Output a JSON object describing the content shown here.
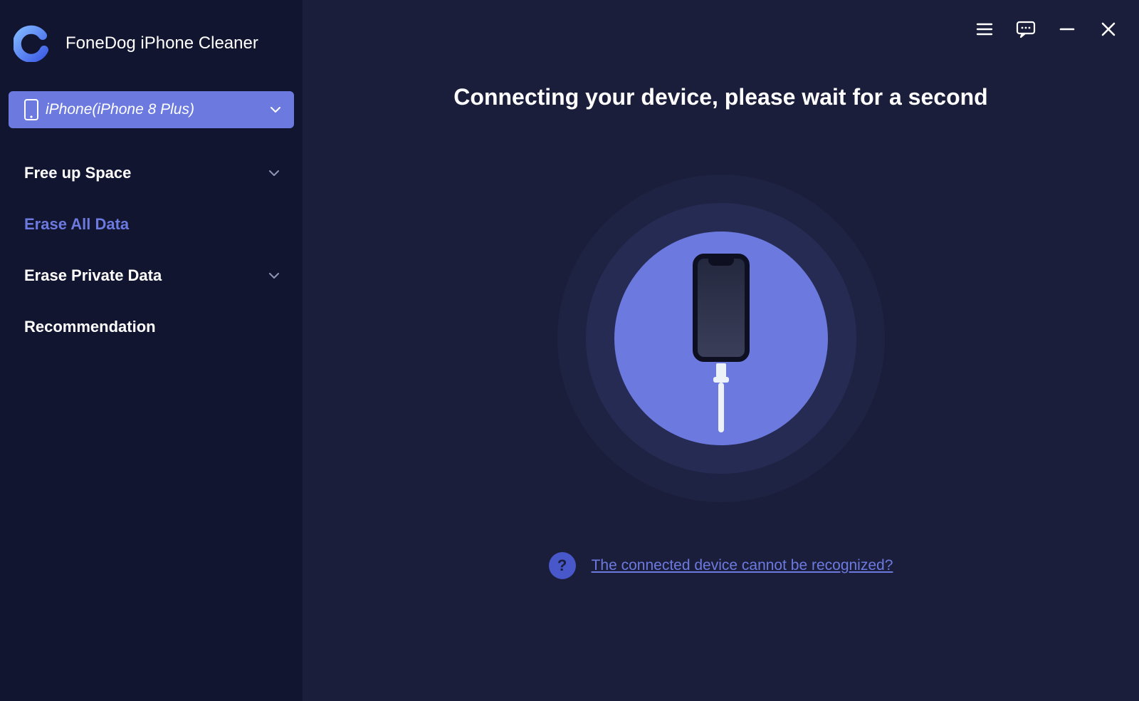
{
  "app_title": "FoneDog iPhone Cleaner",
  "device": {
    "label": "iPhone(iPhone 8 Plus)"
  },
  "sidebar": {
    "items": [
      {
        "label": "Free up Space",
        "expandable": true,
        "active": false
      },
      {
        "label": "Erase All Data",
        "expandable": false,
        "active": true
      },
      {
        "label": "Erase Private Data",
        "expandable": true,
        "active": false
      },
      {
        "label": "Recommendation",
        "expandable": false,
        "active": false
      }
    ]
  },
  "main": {
    "title": "Connecting your device, please wait for a second",
    "help_link": "The connected device cannot be recognized?",
    "help_badge": "?"
  },
  "colors": {
    "accent": "#6c7ae0",
    "bg_main": "#1b1e3a",
    "bg_sidebar": "#12152f"
  }
}
